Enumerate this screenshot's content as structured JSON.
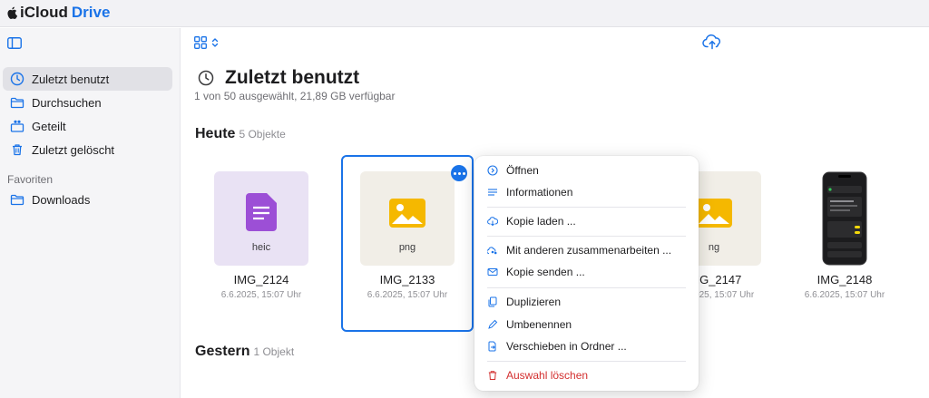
{
  "app": {
    "brand_icloud": "iCloud",
    "brand_drive": "Drive"
  },
  "sidebar": {
    "items": [
      {
        "label": "Zuletzt benutzt",
        "icon": "clock-icon"
      },
      {
        "label": "Durchsuchen",
        "icon": "folder-icon"
      },
      {
        "label": "Geteilt",
        "icon": "shared-folder-icon"
      },
      {
        "label": "Zuletzt gelöscht",
        "icon": "trash-icon"
      }
    ],
    "section_favorites": "Favoriten",
    "favorites": [
      {
        "label": "Downloads",
        "icon": "folder-icon"
      }
    ]
  },
  "main": {
    "title": "Zuletzt benutzt",
    "subtitle": "1 von 50 ausgewählt, 21,89 GB verfügbar",
    "sections": [
      {
        "title": "Heute",
        "count": "5 Objekte"
      },
      {
        "title": "Gestern",
        "count": "1 Objekt"
      }
    ],
    "files": [
      {
        "name": "IMG_2124",
        "date": "6.6.2025, 15:07 Uhr",
        "ext": "heic"
      },
      {
        "name": "IMG_2133",
        "date": "6.6.2025, 15:07 Uhr",
        "ext": "png"
      },
      {
        "name": "IMG_2147",
        "date": "6.6.2025, 15:07 Uhr",
        "ext": "ng"
      },
      {
        "name": "IMG_2148",
        "date": "6.6.2025, 15:07 Uhr"
      }
    ]
  },
  "context_menu": {
    "items": [
      {
        "label": "Öffnen",
        "icon": "open-icon"
      },
      {
        "label": "Informationen",
        "icon": "info-list-icon"
      },
      {
        "label": "Kopie laden ...",
        "icon": "cloud-download-icon"
      },
      {
        "label": "Mit anderen zusammenarbeiten ...",
        "icon": "collaborate-icon"
      },
      {
        "label": "Kopie senden ...",
        "icon": "mail-icon"
      },
      {
        "label": "Duplizieren",
        "icon": "duplicate-icon"
      },
      {
        "label": "Umbenennen",
        "icon": "pencil-icon"
      },
      {
        "label": "Verschieben in Ordner ...",
        "icon": "move-folder-icon"
      },
      {
        "label": "Auswahl löschen",
        "icon": "trash-icon"
      }
    ]
  },
  "colors": {
    "accent": "#1a73e8",
    "danger": "#d32f2f",
    "heic_icon": "#9c4fd6",
    "image_icon": "#f5b800"
  }
}
